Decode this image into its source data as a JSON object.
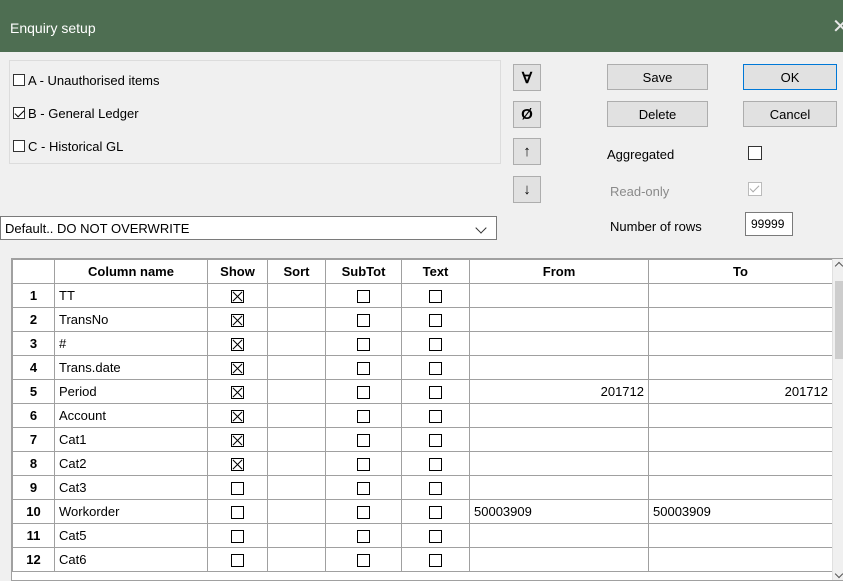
{
  "window": {
    "title": "Enquiry setup",
    "close_glyph": "✕"
  },
  "sources": [
    {
      "label": "A - Unauthorised items",
      "checked": false
    },
    {
      "label": "B - General Ledger",
      "checked": true
    },
    {
      "label": "C - Historical GL",
      "checked": false
    }
  ],
  "toolbar": {
    "select_all_glyph": "∀",
    "clear_glyph": "Ø",
    "move_up_glyph": "↑",
    "move_down_glyph": "↓",
    "save_label": "Save",
    "delete_label": "Delete",
    "ok_label": "OK",
    "cancel_label": "Cancel"
  },
  "options": {
    "aggregated_label": "Aggregated",
    "aggregated_checked": false,
    "readonly_label": "Read-only",
    "readonly_checked": true,
    "rows_label": "Number of rows",
    "rows_value": "99999"
  },
  "template": {
    "selected": "Default.. DO NOT OVERWRITE"
  },
  "grid": {
    "headers": [
      "",
      "Column name",
      "Show",
      "Sort",
      "SubTot",
      "Text",
      "From",
      "To"
    ],
    "rows": [
      {
        "num": "1",
        "name": "TT",
        "show": true,
        "from": "",
        "to": ""
      },
      {
        "num": "2",
        "name": "TransNo",
        "show": true,
        "from": "",
        "to": ""
      },
      {
        "num": "3",
        "name": "#",
        "show": true,
        "from": "",
        "to": ""
      },
      {
        "num": "4",
        "name": "Trans.date",
        "show": true,
        "from": "",
        "to": ""
      },
      {
        "num": "5",
        "name": "Period",
        "show": true,
        "from": "201712",
        "to": "201712",
        "align": "right"
      },
      {
        "num": "6",
        "name": "Account",
        "show": true,
        "from": "",
        "to": ""
      },
      {
        "num": "7",
        "name": "Cat1",
        "show": true,
        "from": "",
        "to": ""
      },
      {
        "num": "8",
        "name": "Cat2",
        "show": true,
        "from": "",
        "to": ""
      },
      {
        "num": "9",
        "name": "Cat3",
        "show": false,
        "from": "",
        "to": ""
      },
      {
        "num": "10",
        "name": "Workorder",
        "show": false,
        "from": "50003909",
        "to": "50003909",
        "align": "left"
      },
      {
        "num": "11",
        "name": "Cat5",
        "show": false,
        "from": "",
        "to": ""
      },
      {
        "num": "12",
        "name": "Cat6",
        "show": false,
        "from": "",
        "to": ""
      }
    ]
  }
}
